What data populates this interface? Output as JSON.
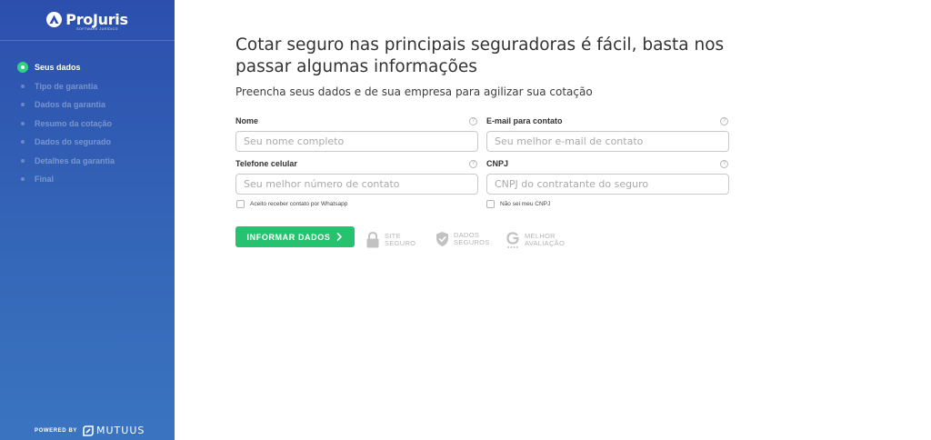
{
  "brand": {
    "name": "ProJuris",
    "tagline": "SOFTWARE JURÍDICO"
  },
  "sidebar": {
    "steps": [
      {
        "label": "Seus dados",
        "active": true
      },
      {
        "label": "Tipo de garantia",
        "active": false
      },
      {
        "label": "Dados da garantia",
        "active": false
      },
      {
        "label": "Resumo da cotação",
        "active": false
      },
      {
        "label": "Dados do segurado",
        "active": false
      },
      {
        "label": "Detalhes da garantia",
        "active": false
      },
      {
        "label": "Final",
        "active": false
      }
    ],
    "powered_by": "POWERED BY",
    "partner": "MUTUUS"
  },
  "main": {
    "title": "Cotar seguro nas principais seguradoras é fácil, basta nos passar algumas informações",
    "subtitle": "Preencha seus dados e de sua empresa para agilizar sua cotação",
    "fields": {
      "name": {
        "label": "Nome",
        "placeholder": "Seu nome completo",
        "value": ""
      },
      "email": {
        "label": "E-mail para contato",
        "placeholder": "Seu melhor e-mail de contato",
        "value": ""
      },
      "phone": {
        "label": "Telefone celular",
        "placeholder": "Seu melhor número de contato",
        "value": ""
      },
      "cnpj": {
        "label": "CNPJ",
        "placeholder": "CNPJ do contratante do seguro",
        "value": ""
      }
    },
    "help_glyph": "?",
    "whatsapp_checkbox": {
      "label": "Aceito receber contato por Whatsapp",
      "checked": false
    },
    "no_cnpj_checkbox": {
      "label": "Não sei meu CNPJ",
      "checked": false
    },
    "submit_label": "INFORMAR DADOS",
    "badges": [
      {
        "line1": "SITE",
        "line2": "SEGURO",
        "icon": "lock-icon"
      },
      {
        "line1": "DADOS",
        "line2": "SEGUROS",
        "icon": "shield-icon"
      },
      {
        "line1": "MELHOR",
        "line2": "AVALIAÇÃO",
        "icon": "google-icon"
      }
    ]
  },
  "colors": {
    "sidebar_top": "#2c4fae",
    "sidebar_bottom": "#3a74c0",
    "accent_green": "#27c26f",
    "active_step_dot": "#2ed27f"
  }
}
